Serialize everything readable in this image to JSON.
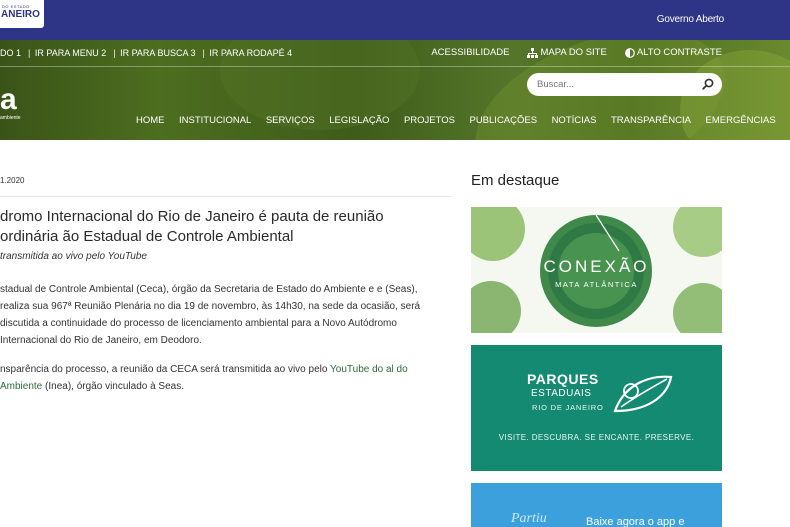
{
  "gov": {
    "logo_small": "DO ESTADO",
    "logo_big": "ANEIRO",
    "open_gov": "Governo Aberto"
  },
  "skip_links": [
    "DO 1",
    "IR PARA MENU 2",
    "IR PARA BUSCA 3",
    "IR PARA RODAPÉ 4"
  ],
  "util": {
    "accessibility": "ACESSIBILIDADE",
    "sitemap": "MAPA DO SITE",
    "contrast": "ALTO CONTRASTE"
  },
  "search": {
    "placeholder": "Buscar..."
  },
  "brand": {
    "letter": "a",
    "sub": "ambiente"
  },
  "nav": [
    "HOME",
    "INSTITUCIONAL",
    "SERVIÇOS",
    "LEGISLAÇÃO",
    "PROJETOS",
    "PUBLICAÇÕES",
    "NOTÍCIAS",
    "TRANSPARÊNCIA",
    "EMERGÊNCIAS"
  ],
  "article": {
    "date": "1.2020",
    "title": "dromo Internacional do Rio de Janeiro é pauta de reunião ordinária ão Estadual de Controle Ambiental",
    "subtitle": "transmitida ao vivo pelo YouTube",
    "p1": "stadual de Controle Ambiental (Ceca), órgão da Secretaria de Estado do Ambiente e e (Seas), realiza sua 967ª Reunião Plenária no dia 19 de novembro, às 14h30, na sede da ocasião, será discutida a continuidade do processo de licenciamento ambiental para a Novo Autódromo Internacional do Rio de Janeiro, em Deodoro.",
    "p2_before": "nsparência do processo, a reunião da CECA será transmitida ao vivo pelo ",
    "p2_link": "YouTube do al do Ambiente",
    "p2_after": " (Inea), órgão vinculado à Seas."
  },
  "sidebar": {
    "title": "Em destaque",
    "conexao_title": "CONEXÃO",
    "conexao_sub": "MATA ATLÂNTICA",
    "parques_1": "PARQUES",
    "parques_2": "ESTADUAIS",
    "parques_3": "RIO DE JANEIRO",
    "parques_tagline": "VISITE. DESCUBRA. SE ENCANTE. PRESERVE.",
    "app_logo": "Partiu",
    "app_text": "Baixe agora o app e"
  },
  "colors": {
    "gov_bar": "#2e3486",
    "parques_bg": "#148a72",
    "app_bg": "#3ba0dc",
    "link": "#2e6b3a"
  }
}
